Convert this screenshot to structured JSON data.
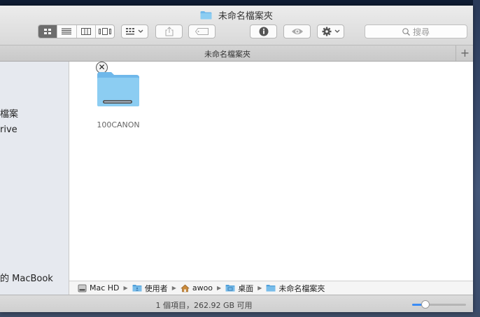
{
  "window": {
    "title": "未命名檔案夾",
    "tab_title": "未命名檔案夾",
    "tab_add": "+"
  },
  "toolbar": {
    "view_modes": [
      "icon-view",
      "list-view",
      "column-view",
      "cover-flow-view"
    ],
    "active_view": "icon-view",
    "search_placeholder": "搜尋"
  },
  "sidebar": {
    "items": [
      "檔案",
      "rive",
      "的 MacBook"
    ]
  },
  "content": {
    "items": [
      {
        "name": "100CANON",
        "icon": "folder-icon",
        "badge": "✕"
      }
    ]
  },
  "pathbar": {
    "crumbs": [
      {
        "label": "Mac HD",
        "icon": "hard-drive-icon"
      },
      {
        "label": "使用者",
        "icon": "folder-icon"
      },
      {
        "label": "awoo",
        "icon": "home-icon"
      },
      {
        "label": "桌面",
        "icon": "folder-icon"
      },
      {
        "label": "未命名檔案夾",
        "icon": "folder-icon"
      }
    ]
  },
  "status": {
    "text": "1 個項目，262.92 GB 可用",
    "icon_size_slider": 0.25
  },
  "colors": {
    "folder": "#8ccdf2",
    "accent": "#3b8cf5"
  }
}
